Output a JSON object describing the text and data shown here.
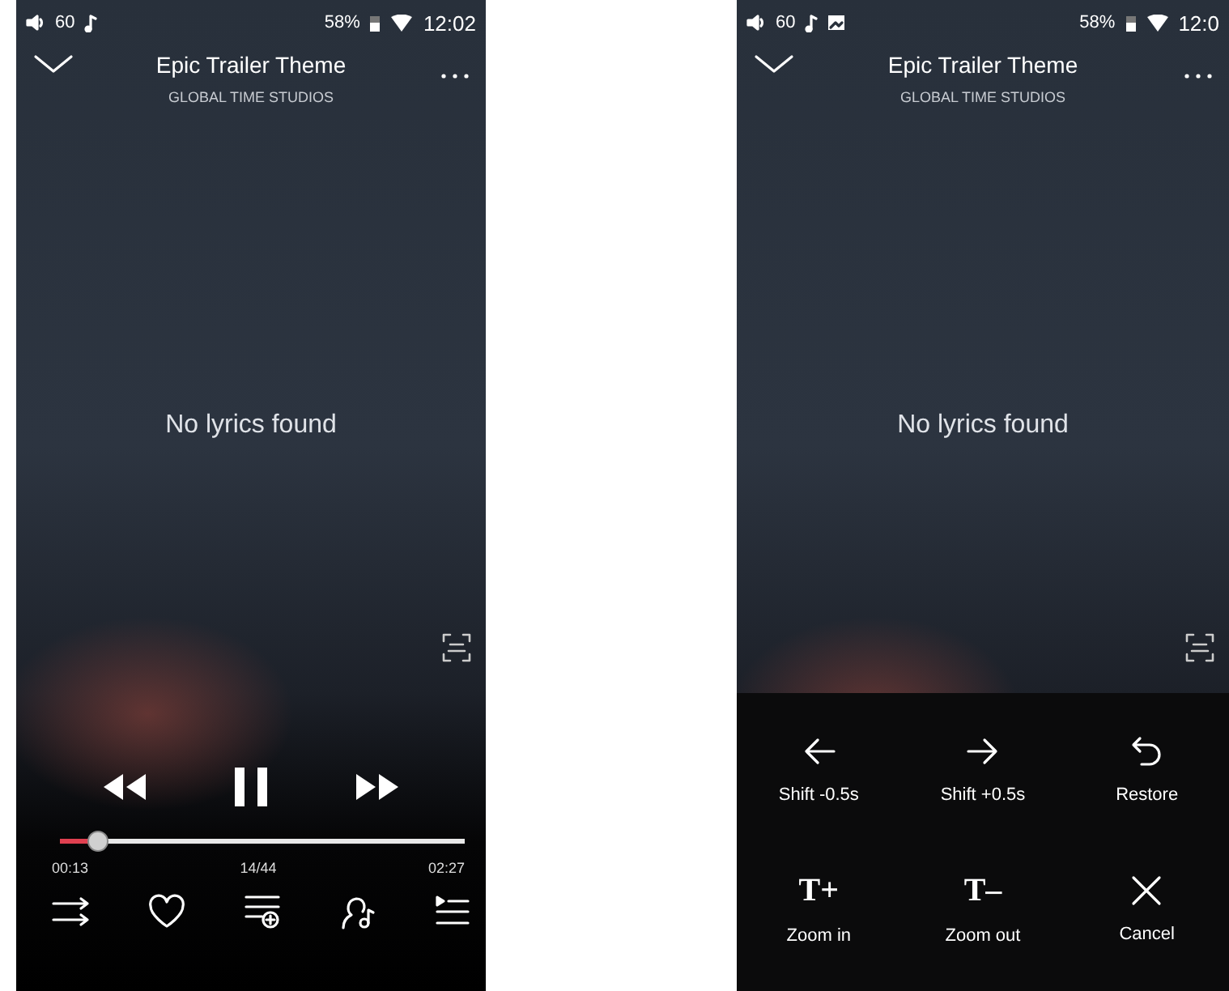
{
  "phones": [
    {
      "status_bar": {
        "volume": "60",
        "battery": "58%",
        "time": "12:02",
        "image_notification": false
      },
      "header": {
        "title": "Epic Trailer Theme",
        "artist": "GLOBAL TIME STUDIOS"
      },
      "lyrics": {
        "message": "No lyrics found"
      },
      "playback": {
        "playing": true,
        "level": 0.09,
        "elapsed": "00:13",
        "position": "14/44",
        "duration": "02:27"
      }
    },
    {
      "status_bar": {
        "volume": "60",
        "battery": "58%",
        "time": "12:0",
        "image_notification": true
      },
      "header": {
        "title": "Epic Trailer Theme",
        "artist": "GLOBAL TIME STUDIOS"
      },
      "lyrics": {
        "message": "No lyrics found"
      },
      "adjust_menu": {
        "items": [
          {
            "kind": "shift_back",
            "label": "Shift -0.5s"
          },
          {
            "kind": "shift_forward",
            "label": "Shift +0.5s"
          },
          {
            "kind": "restore",
            "label": "Restore"
          },
          {
            "kind": "zoom_in",
            "glyph": "T+",
            "label": "Zoom in"
          },
          {
            "kind": "zoom_out",
            "glyph": "T–",
            "label": "Zoom out"
          },
          {
            "kind": "cancel",
            "label": "Cancel"
          }
        ]
      }
    }
  ]
}
